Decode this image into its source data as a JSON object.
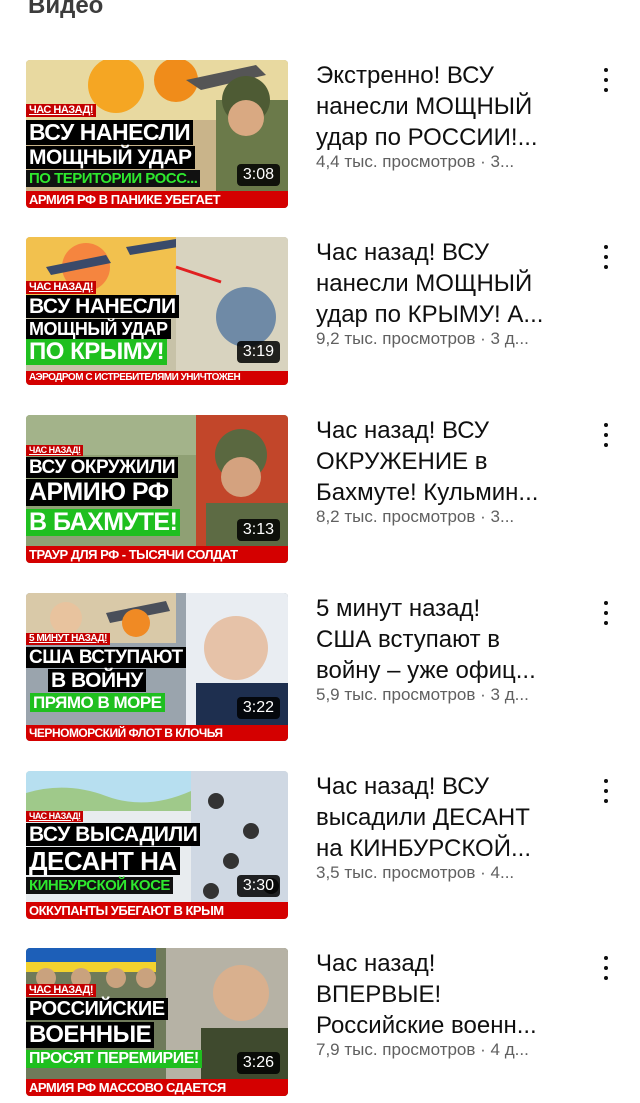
{
  "section": {
    "title": "Видео"
  },
  "videos": [
    {
      "title": "Экстренно! ВСУ\nнанесли МОЩНЫЙ\nудар по РОССИИ!...",
      "meta": "4,4 тыс. просмотров · 3...",
      "duration": "3:08",
      "thumb": {
        "small": "ЧАС НАЗАД!",
        "line1": "ВСУ НАНЕСЛИ",
        "line2": "МОЩНЫЙ УДАР",
        "line3": "ПО ТЕРИТОРИИ РОСС...",
        "bottom": "АРМИЯ РФ В ПАНИКЕ УБЕГАЕТ"
      },
      "more_icon": "more-vertical-icon"
    },
    {
      "title": "Час назад! ВСУ\nнанесли МОЩНЫЙ\nудар по КРЫМУ! А...",
      "meta": "9,2 тыс. просмотров · 3 д...",
      "duration": "3:19",
      "thumb": {
        "small": "ЧАС НАЗАД!",
        "line1": "ВСУ НАНЕСЛИ",
        "line2": "МОЩНЫЙ УДАР",
        "line3": "ПО КРЫМУ!",
        "bottom": "АЭРОДРОМ С ИСТРЕБИТЕЛЯМИ УНИЧТОЖЕН"
      },
      "more_icon": "more-vertical-icon"
    },
    {
      "title": "Час назад! ВСУ\nОКРУЖЕНИЕ в\nБахмуте! Кульмин...",
      "meta": "8,2 тыс. просмотров · 3...",
      "duration": "3:13",
      "thumb": {
        "small": "ЧАС НАЗАД!",
        "line1": "ВСУ ОКРУЖИЛИ",
        "line2": "АРМИЮ РФ",
        "line3": "В БАХМУТЕ!",
        "bottom": "ТРАУР ДЛЯ РФ - ТЫСЯЧИ СОЛДАТ"
      },
      "more_icon": "more-vertical-icon"
    },
    {
      "title": "5 минут назад!\nСША вступают в\nвойну – уже офиц...",
      "meta": "5,9 тыс. просмотров · 3 д...",
      "duration": "3:22",
      "thumb": {
        "small": "5 МИНУТ НАЗАД!",
        "line1": "США ВСТУПАЮТ",
        "line2": "В ВОЙНУ",
        "line3": "ПРЯМО В МОРЕ",
        "bottom": "ЧЕРНОМОРСКИЙ ФЛОТ В КЛОЧЬЯ"
      },
      "more_icon": "more-vertical-icon"
    },
    {
      "title": "Час назад! ВСУ\nвысадили ДЕСАНТ\nна КИНБУРСКОЙ...",
      "meta": "3,5 тыс. просмотров · 4...",
      "duration": "3:30",
      "thumb": {
        "small": "ЧАС НАЗАД!",
        "line1": "ВСУ ВЫСАДИЛИ",
        "line2": "ДЕСАНТ НА",
        "line3": "КИНБУРСКОЙ КОСЕ",
        "bottom": "ОККУПАНТЫ УБЕГАЮТ В КРЫМ"
      },
      "more_icon": "more-vertical-icon"
    },
    {
      "title": "Час назад!\nВПЕРВЫЕ!\nРоссийские военн...",
      "meta": "7,9 тыс. просмотров · 4 д...",
      "duration": "3:26",
      "thumb": {
        "small": "ЧАС НАЗАД!",
        "line1": "РОССИЙСКИЕ",
        "line2": "ВОЕННЫЕ",
        "line3": "ПРОСЯТ ПЕРЕМИРИЕ!",
        "bottom": "АРМИЯ РФ МАССОВО СДАЕТСЯ"
      },
      "more_icon": "more-vertical-icon"
    }
  ]
}
